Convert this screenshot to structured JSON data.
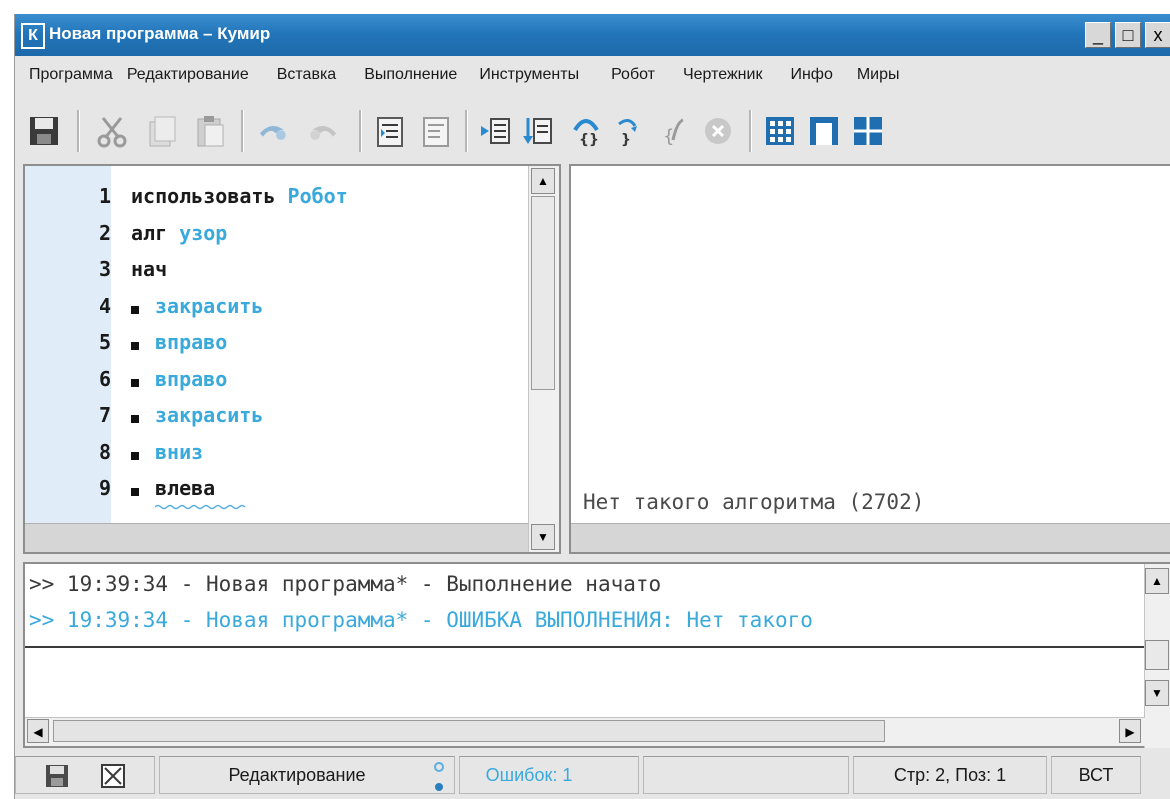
{
  "window": {
    "app_letter": "К",
    "title": "Новая программа – Кумир",
    "controls": [
      "_",
      "□",
      "x"
    ]
  },
  "menu": [
    "Программа",
    "Редактирование",
    "Вставка",
    "Выполнение",
    "Инструменты",
    "Робот",
    "Чертежник",
    "Инфо",
    "Миры"
  ],
  "toolbar_icons": [
    "save-icon",
    "cut-icon",
    "copy-icon",
    "paste-icon",
    "undo-icon",
    "redo-icon",
    "indent-icon",
    "unindent-icon",
    "run-icon",
    "step-icon",
    "step-in-icon",
    "step-over-icon",
    "step-out-icon",
    "stop-icon",
    "grid-view-icon",
    "single-view-icon",
    "split-view-icon"
  ],
  "editor": {
    "lines": [
      {
        "num": "1",
        "parts": [
          {
            "text": "использовать",
            "type": "kw"
          },
          {
            "text": " Робот",
            "type": "nm"
          }
        ],
        "bullet": false
      },
      {
        "num": "2",
        "parts": [
          {
            "text": "алг",
            "type": "kw"
          },
          {
            "text": " узор",
            "type": "nm"
          }
        ],
        "bullet": false
      },
      {
        "num": "3",
        "parts": [
          {
            "text": "нач",
            "type": "kw"
          }
        ],
        "bullet": false
      },
      {
        "num": "4",
        "parts": [
          {
            "text": "закрасить",
            "type": "nm"
          }
        ],
        "bullet": true
      },
      {
        "num": "5",
        "parts": [
          {
            "text": "вправо",
            "type": "nm"
          }
        ],
        "bullet": true
      },
      {
        "num": "6",
        "parts": [
          {
            "text": "вправо",
            "type": "nm"
          }
        ],
        "bullet": true
      },
      {
        "num": "7",
        "parts": [
          {
            "text": "закрасить",
            "type": "nm"
          }
        ],
        "bullet": true
      },
      {
        "num": "8",
        "parts": [
          {
            "text": "вниз",
            "type": "nm"
          }
        ],
        "bullet": true
      },
      {
        "num": "9",
        "parts": [
          {
            "text": "влева",
            "type": "kw"
          }
        ],
        "bullet": true
      }
    ]
  },
  "output": {
    "message": "Нет такого алгоритма (2702)"
  },
  "console": {
    "line1": ">> 19:39:34 - Новая программа* - Выполнение начато",
    "line2": ">> 19:39:34 - Новая программа* - ОШИБКА ВЫПОЛНЕНИЯ: Нет такого"
  },
  "status": {
    "mode": "Редактирование",
    "errors": "Ошибок: 1",
    "position": "Стр: 2, Поз: 1",
    "insert_mode": "ВСТ"
  },
  "colors": {
    "title_bar": "#2376ba",
    "keyword": "#1a1a1a",
    "name": "#3aa9dc",
    "gutter": "#e0ecf7",
    "console_error": "#3aa9dc"
  }
}
